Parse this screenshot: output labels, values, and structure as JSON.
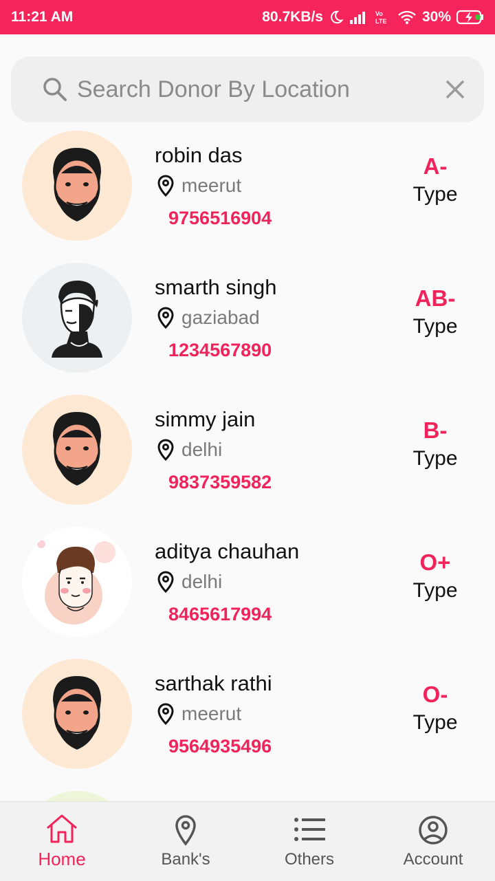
{
  "status_bar": {
    "time": "11:21 AM",
    "speed": "80.7KB/s",
    "battery": "30%",
    "icons": [
      "moon-icon",
      "signal-icon",
      "volte-icon",
      "wifi-icon",
      "battery-charging-icon"
    ]
  },
  "search": {
    "placeholder": "Search Donor By Location",
    "value": ""
  },
  "donors": [
    {
      "name": "robin das",
      "location": "meerut",
      "phone": "9756516904",
      "blood_group": "A-",
      "type_label": "Type",
      "avatar": "bearded-man-avatar"
    },
    {
      "name": "smarth singh",
      "location": "gaziabad",
      "phone": "1234567890",
      "blood_group": "AB-",
      "type_label": "Type",
      "avatar": "sketch-man-avatar"
    },
    {
      "name": "simmy jain",
      "location": "delhi",
      "phone": "9837359582",
      "blood_group": "B-",
      "type_label": "Type",
      "avatar": "bearded-man-avatar"
    },
    {
      "name": "aditya chauhan",
      "location": "delhi",
      "phone": "8465617994",
      "blood_group": "O+",
      "type_label": "Type",
      "avatar": "cartoon-man-avatar"
    },
    {
      "name": "sarthak rathi",
      "location": "meerut",
      "phone": "9564935496",
      "blood_group": "O-",
      "type_label": "Type",
      "avatar": "bearded-man-avatar"
    }
  ],
  "bottom_nav": {
    "items": [
      {
        "label": "Home",
        "icon": "home-icon",
        "active": true
      },
      {
        "label": "Bank's",
        "icon": "location-pin-icon",
        "active": false
      },
      {
        "label": "Others",
        "icon": "list-icon",
        "active": false
      },
      {
        "label": "Account",
        "icon": "account-circle-icon",
        "active": false
      }
    ]
  },
  "colors": {
    "accent": "#f0245a",
    "status_bar": "#f5245a",
    "background": "#fafafa"
  }
}
